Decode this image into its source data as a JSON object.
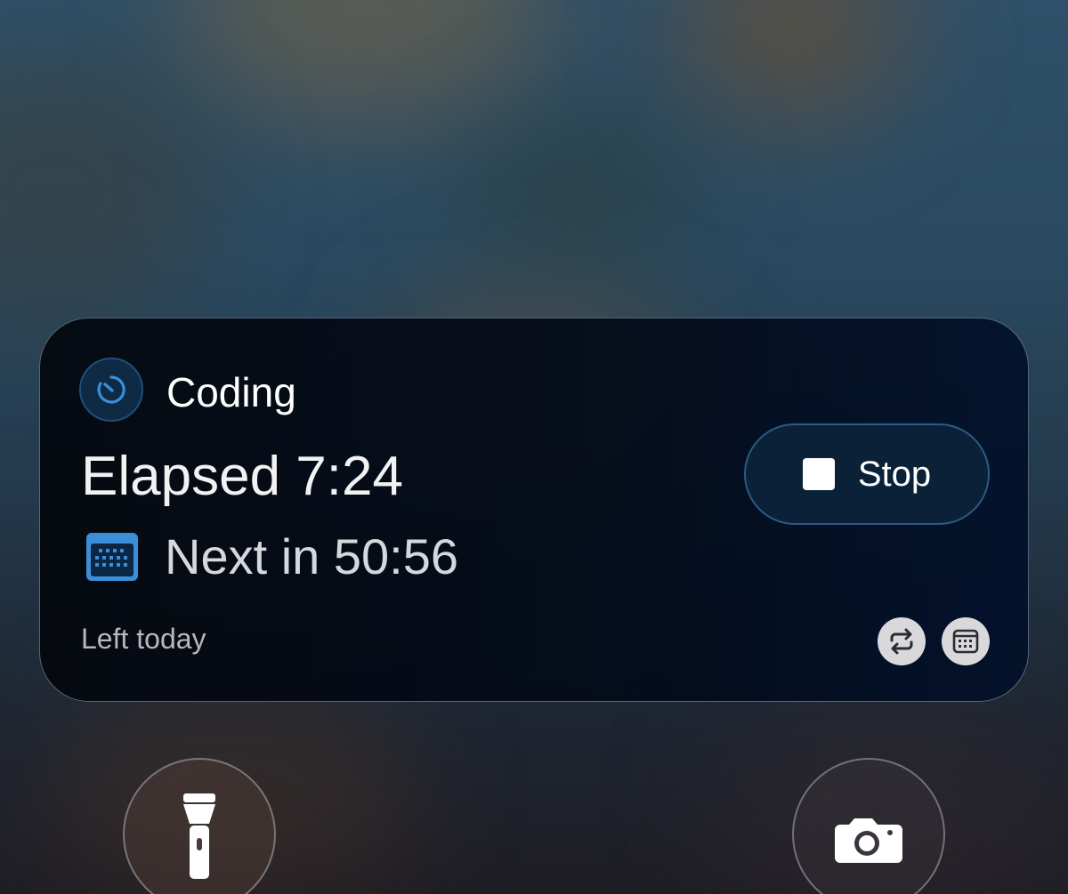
{
  "wallpaper": {
    "top_color": "#2f5068",
    "bottom_color": "#1f1d24"
  },
  "live_activity": {
    "app_icon": "timer-icon",
    "title": "Coding",
    "elapsed": "Elapsed 7:24",
    "next_icon": "calendar-icon",
    "next": "Next in 50:56",
    "stop_button": {
      "icon": "stop-square-icon",
      "label": "Stop"
    },
    "footer_label": "Left today",
    "actions": [
      {
        "icon": "repeat-icon"
      },
      {
        "icon": "calendar-icon"
      }
    ],
    "accent_color": "#3a8fd9"
  },
  "lock_screen_controls": {
    "left": {
      "icon": "flashlight-icon"
    },
    "right": {
      "icon": "camera-icon"
    }
  }
}
